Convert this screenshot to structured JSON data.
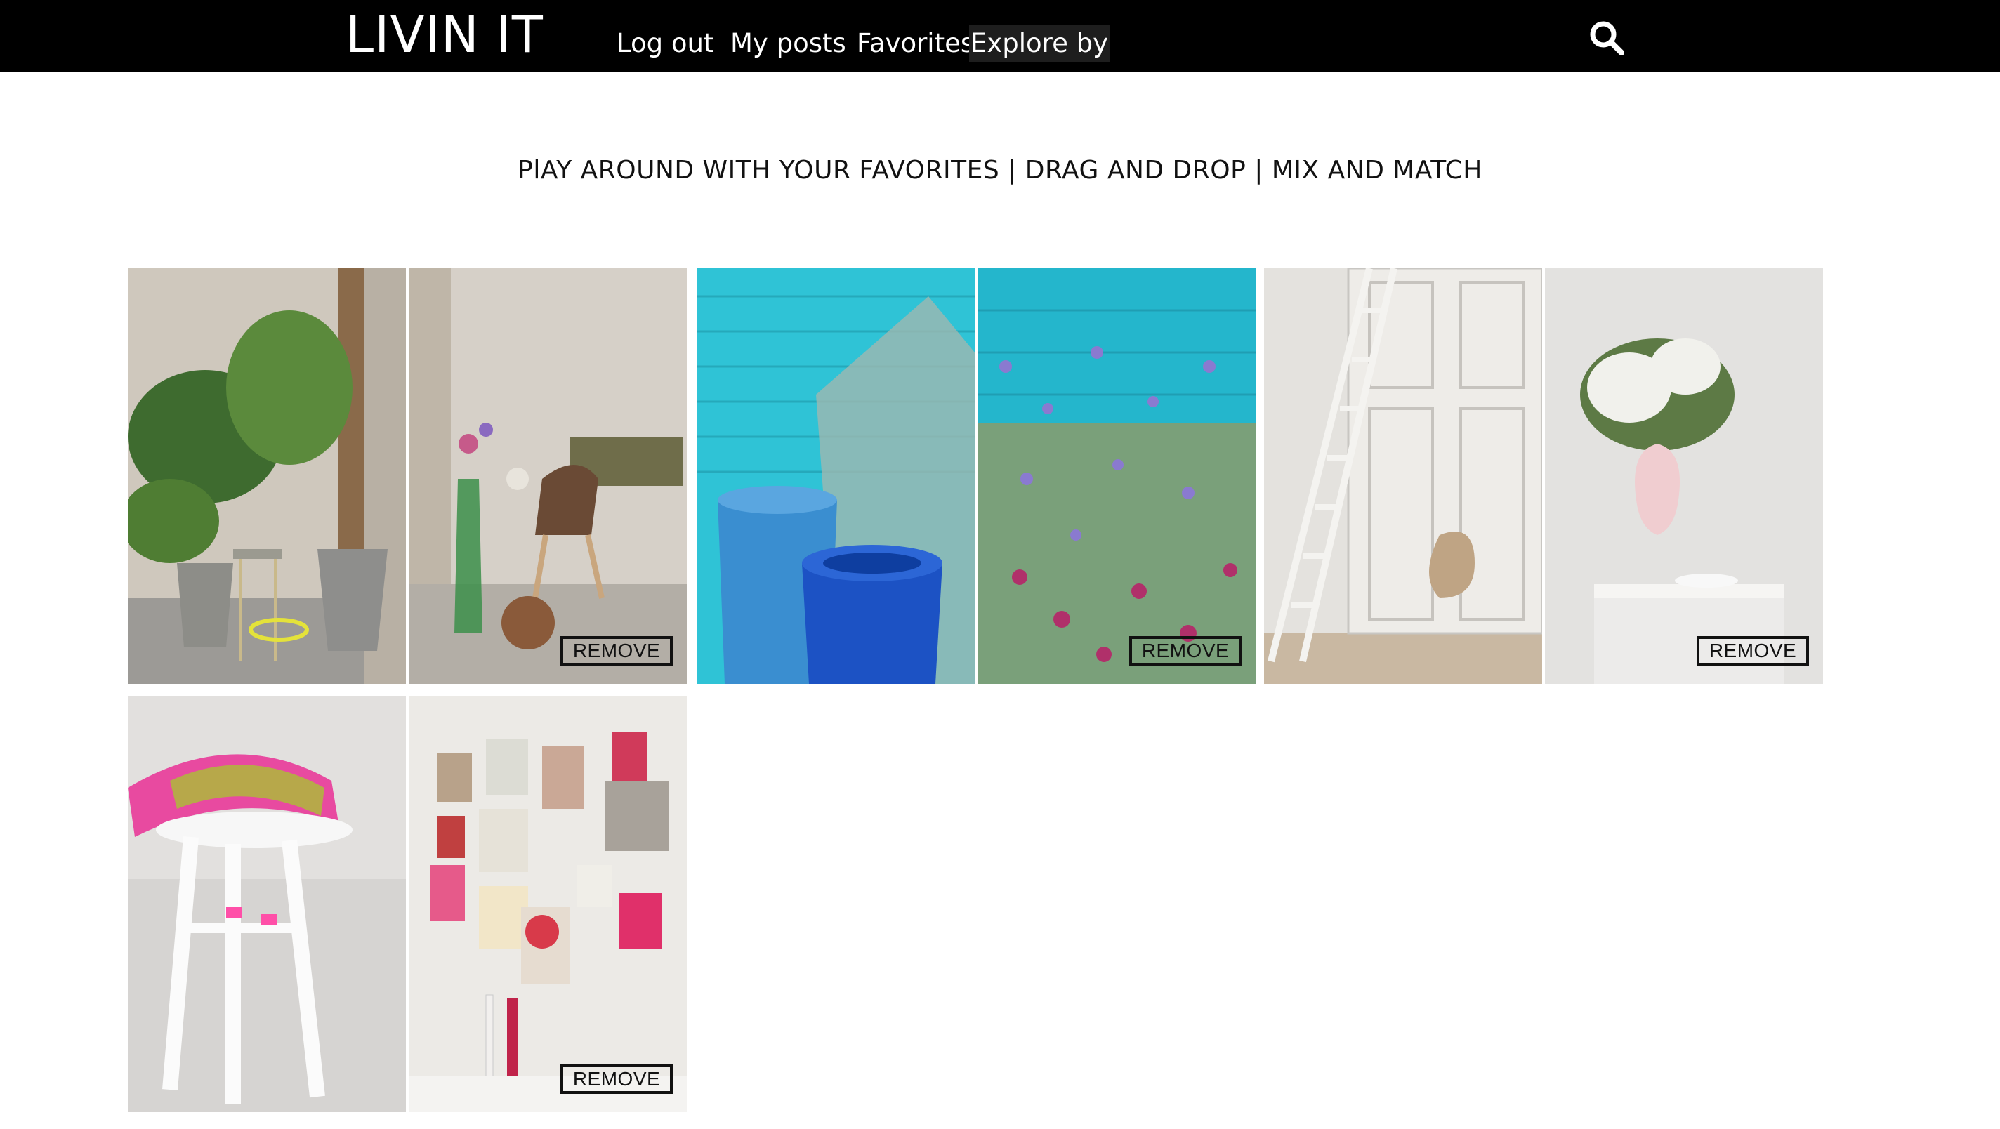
{
  "header": {
    "logo": "LIVIN IT",
    "nav": [
      {
        "label": "Log out"
      },
      {
        "label": "My posts"
      },
      {
        "label": "Favorites"
      },
      {
        "label": "Explore by"
      }
    ],
    "search_icon": "search-icon"
  },
  "main": {
    "headline": "PlAY AROUND WITH YOUR FAVORITES | DRAG AND DROP | MIX AND MATCH",
    "remove_label": "REMOVE"
  },
  "colors": {
    "topbar": "#000000",
    "background": "#ffffff",
    "text": "#111111"
  }
}
